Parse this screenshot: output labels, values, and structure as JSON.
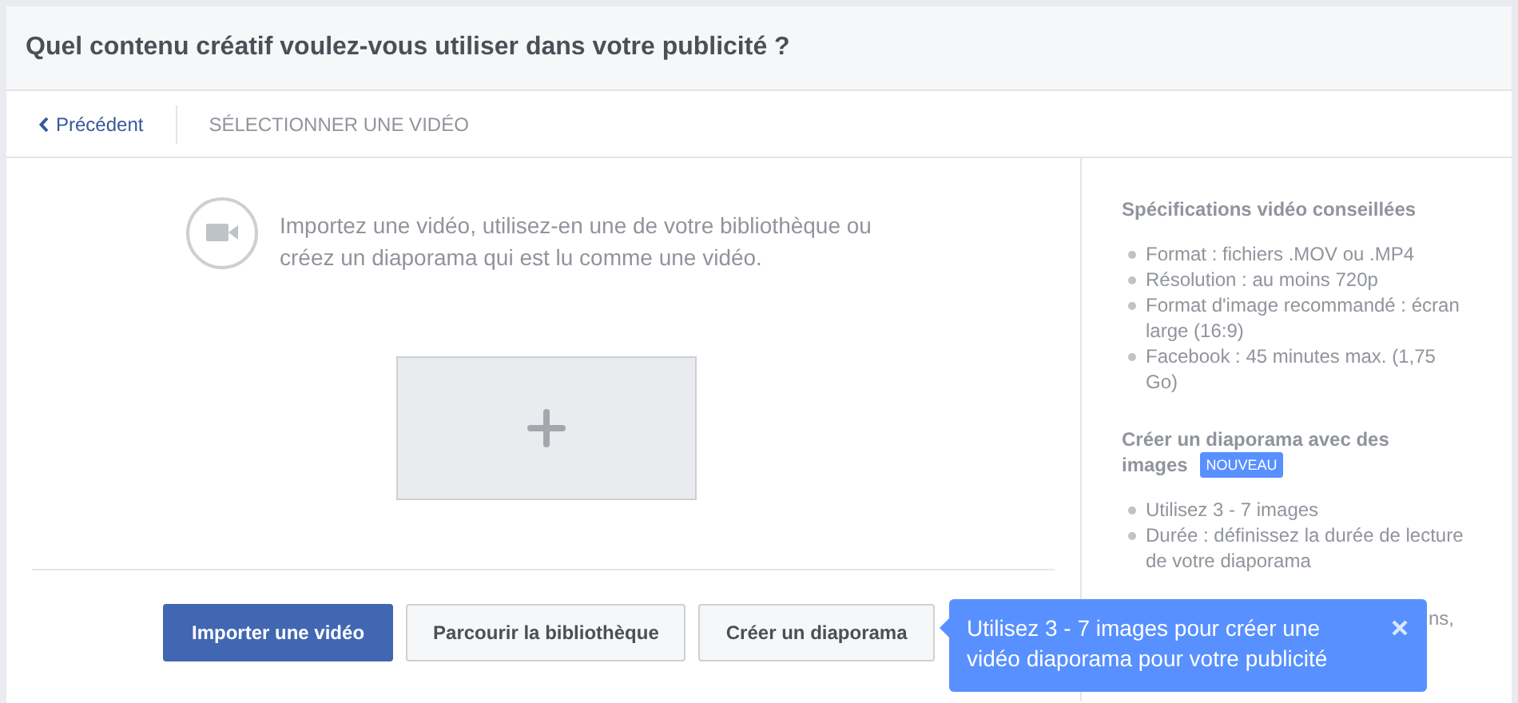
{
  "dialog": {
    "title": "Quel contenu créatif voulez-vous utiliser dans votre publicité ?"
  },
  "nav": {
    "back": "Précédent",
    "step": "SÉLECTIONNER UNE VIDÉO"
  },
  "upload": {
    "description": "Importez une vidéo, utilisez-en une de votre bibliothèque ou créez un diaporama qui est lu comme une vidéo.",
    "buttons": [
      {
        "label": "Importer une vidéo",
        "primary": true
      },
      {
        "label": "Parcourir la bibliothèque",
        "primary": false
      },
      {
        "label": "Créer un diaporama",
        "primary": false
      }
    ]
  },
  "sidebar": {
    "sections": [
      {
        "title": "Spécifications vidéo conseillées",
        "items": [
          "Format : fichiers .MOV ou .MP4",
          "Résolution : au moins 720p",
          "Format d'image recommandé : écran large (16:9)",
          "Facebook : 45 minutes max. (1,75 Go)"
        ]
      },
      {
        "title": "Créer un diaporama avec des images",
        "badge": "NOUVEAU",
        "items": [
          "Utilisez 3 - 7 images",
          "Durée : définissez la durée de lecture de votre diaporama"
        ]
      }
    ],
    "partial_text": "ns,"
  },
  "tooltip": {
    "text": "Utilisez 3 - 7 images pour créer une vidéo diaporama pour votre publicité"
  }
}
